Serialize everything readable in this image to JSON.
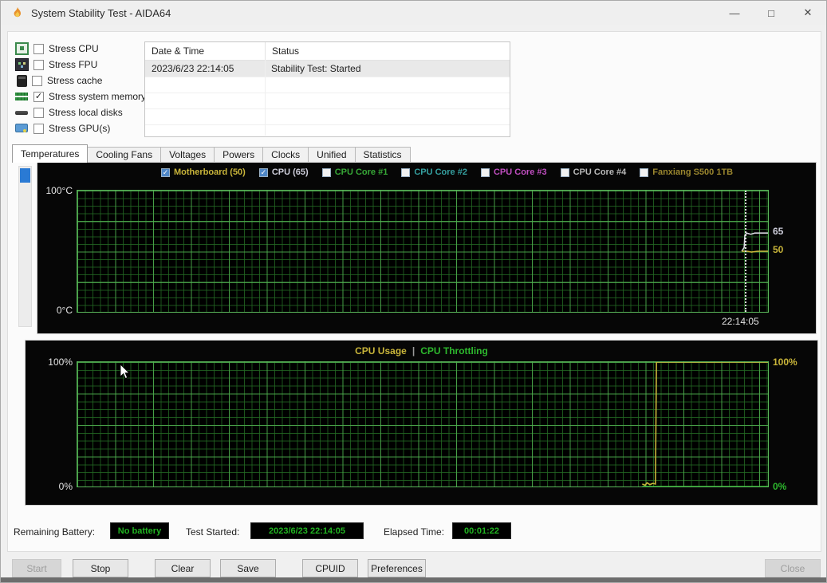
{
  "window": {
    "title": "System Stability Test - AIDA64",
    "minimize_glyph": "—",
    "maximize_glyph": "□",
    "close_glyph": "✕"
  },
  "stress_options": {
    "items": [
      {
        "label": "Stress CPU",
        "check": ""
      },
      {
        "label": "Stress FPU",
        "check": ""
      },
      {
        "label": "Stress cache",
        "check": ""
      },
      {
        "label": "Stress system memory",
        "check": "✓"
      },
      {
        "label": "Stress local disks",
        "check": ""
      },
      {
        "label": "Stress GPU(s)",
        "check": ""
      }
    ]
  },
  "log": {
    "columns": [
      "Date & Time",
      "Status"
    ],
    "rows": [
      {
        "datetime": "2023/6/23 22:14:05",
        "status": "Stability Test: Started"
      }
    ]
  },
  "tabs": {
    "active": "Temperatures",
    "items": [
      {
        "label": "Temperatures"
      },
      {
        "label": "Cooling Fans"
      },
      {
        "label": "Voltages"
      },
      {
        "label": "Powers"
      },
      {
        "label": "Clocks"
      },
      {
        "label": "Unified"
      },
      {
        "label": "Statistics"
      }
    ]
  },
  "temp_chart": {
    "legend": [
      {
        "label": "Motherboard (50)",
        "color": "#c9b53a",
        "check": "✓",
        "box_bg": "#4f87c7"
      },
      {
        "label": "CPU (65)",
        "color": "#cfcfdc",
        "check": "✓",
        "box_bg": "#4f87c7"
      },
      {
        "label": "CPU Core #1",
        "color": "#37a837",
        "check": "",
        "box_bg": "#f2f2f2"
      },
      {
        "label": "CPU Core #2",
        "color": "#35a0a0",
        "check": "",
        "box_bg": "#f2f2f2"
      },
      {
        "label": "CPU Core #3",
        "color": "#c04ec0",
        "check": "",
        "box_bg": "#f2f2f2"
      },
      {
        "label": "CPU Core #4",
        "color": "#b9b9b9",
        "check": "",
        "box_bg": "#f2f2f2"
      },
      {
        "label": "Fanxiang S500 1TB",
        "color": "#9a862e",
        "check": "",
        "box_bg": "#f2f2f2"
      }
    ],
    "y_max_label": "100°C",
    "y_min_label": "0°C",
    "value_labels": [
      {
        "text": "65",
        "color": "#cfcfdc"
      },
      {
        "text": "50",
        "color": "#c9b53a"
      }
    ],
    "time_label": "22:14:05"
  },
  "usage_chart": {
    "title_left": "CPU Usage",
    "title_sep": "|",
    "title_right": "CPU Throttling",
    "title_left_color": "#c9b53a",
    "title_sep_color": "#9a9a9a",
    "title_right_color": "#2db82d",
    "left_top": "100%",
    "left_bottom": "0%",
    "right_top": "100%",
    "right_bottom": "0%",
    "right_top_color": "#c9b53a",
    "right_bottom_color": "#2db82d"
  },
  "chart_data": {
    "temperature": {
      "type": "line",
      "ylim": [
        0,
        100
      ],
      "y_unit": "°C",
      "cursor_x": 0.9666,
      "cursor_time": "22:14:05",
      "series": [
        {
          "name": "CPU",
          "color": "#d8d8e0",
          "end_value": 65,
          "points": [
            [
              0.962,
              50
            ],
            [
              0.9655,
              53
            ],
            [
              0.9665,
              63
            ],
            [
              0.969,
              65
            ],
            [
              0.975,
              64
            ],
            [
              0.981,
              65
            ],
            [
              1,
              65
            ]
          ]
        },
        {
          "name": "Motherboard",
          "color": "#c9b53a",
          "end_value": 50,
          "points": [
            [
              0.962,
              50
            ],
            [
              0.97,
              50
            ],
            [
              0.976,
              49.3
            ],
            [
              0.985,
              50
            ],
            [
              1,
              50
            ]
          ]
        }
      ]
    },
    "cpu_usage": {
      "type": "line",
      "ylim": [
        0,
        100
      ],
      "y_unit": "%",
      "series": [
        {
          "name": "CPU Usage",
          "color": "#c9b53a",
          "end_value": 100,
          "points": [
            [
              0.818,
              2
            ],
            [
              0.822,
              1
            ],
            [
              0.825,
              3
            ],
            [
              0.829,
              1.5
            ],
            [
              0.833,
              2.5
            ],
            [
              0.837,
              2
            ],
            [
              0.8385,
              100
            ],
            [
              1,
              100
            ]
          ]
        },
        {
          "name": "CPU Throttling",
          "color": "#2db82d",
          "end_value": 0,
          "points": [
            [
              0.818,
              0
            ],
            [
              1,
              0
            ]
          ]
        }
      ]
    }
  },
  "status_bar": {
    "battery_label": "Remaining Battery:",
    "battery_value": "No battery",
    "started_label": "Test Started:",
    "started_value": "2023/6/23 22:14:05",
    "elapsed_label": "Elapsed Time:",
    "elapsed_value": "00:01:22",
    "value_color": "#21b421"
  },
  "buttons": {
    "start": "Start",
    "stop": "Stop",
    "clear": "Clear",
    "save": "Save",
    "cpuid": "CPUID",
    "preferences": "Preferences",
    "close": "Close"
  }
}
